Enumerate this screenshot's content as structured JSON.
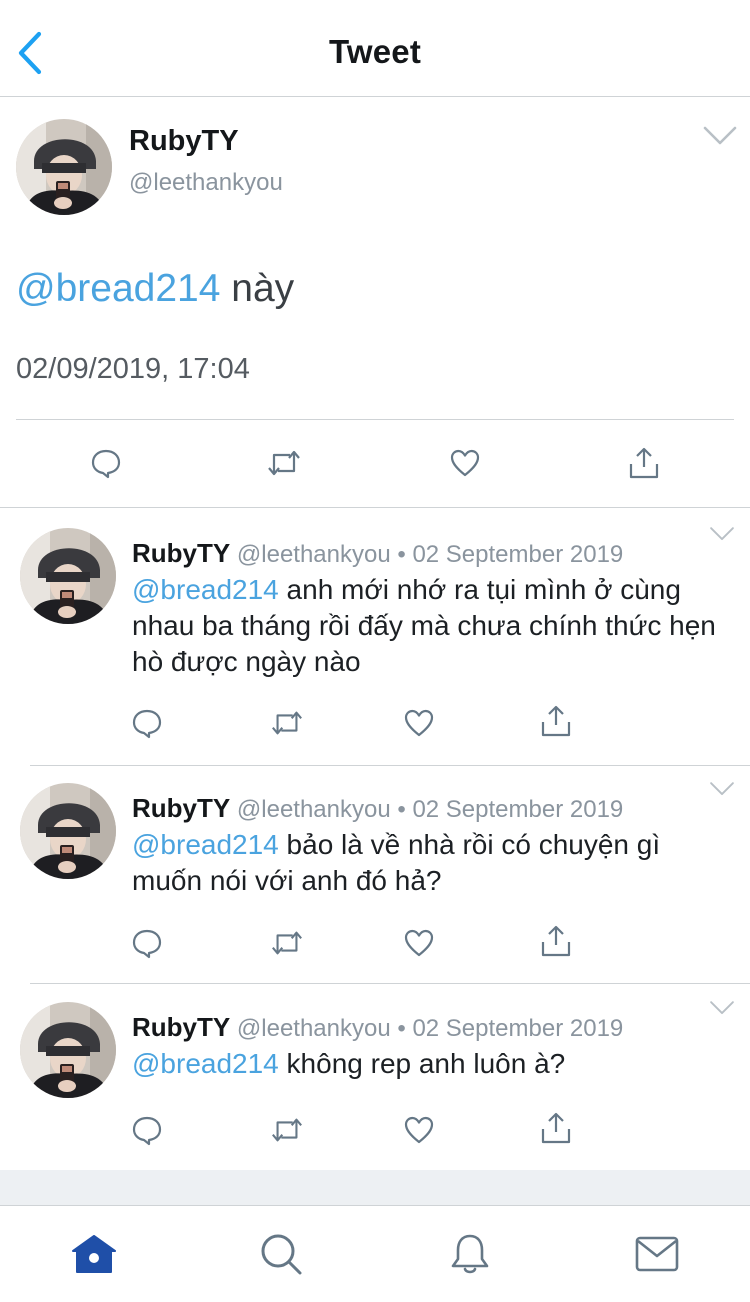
{
  "navbar": {
    "title": "Tweet",
    "back_icon": "chevron-left-icon"
  },
  "colors": {
    "accent": "#1da1f2",
    "mention": "#4aa3df",
    "muted": "#8a949e",
    "tab_active": "#1f4fa8"
  },
  "main_tweet": {
    "name": "RubyTY",
    "handle": "@leethankyou",
    "mention": "@bread214",
    "text": " này",
    "timestamp": "02/09/2019, 17:04",
    "actions": [
      "reply-icon",
      "retweet-icon",
      "like-icon",
      "share-icon"
    ]
  },
  "replies": [
    {
      "name": "RubyTY",
      "meta": " @leethankyou • 02 September 2019",
      "mention": "@bread214",
      "text": " anh mới nhớ ra tụi mình ở cùng nhau ba tháng rồi đấy mà chưa chính thức hẹn hò được ngày nào"
    },
    {
      "name": "RubyTY",
      "meta": " @leethankyou • 02 September 2019",
      "mention": "@bread214",
      "text": " bảo là về nhà rồi có chuyện gì muốn nói với anh đó hả?"
    },
    {
      "name": "RubyTY",
      "meta": " @leethankyou • 02 September 2019",
      "mention": "@bread214",
      "text": " không rep anh luôn à?"
    }
  ],
  "tabbar": {
    "items": [
      "home-icon",
      "search-icon",
      "notifications-icon",
      "messages-icon"
    ],
    "active": "home-icon"
  }
}
